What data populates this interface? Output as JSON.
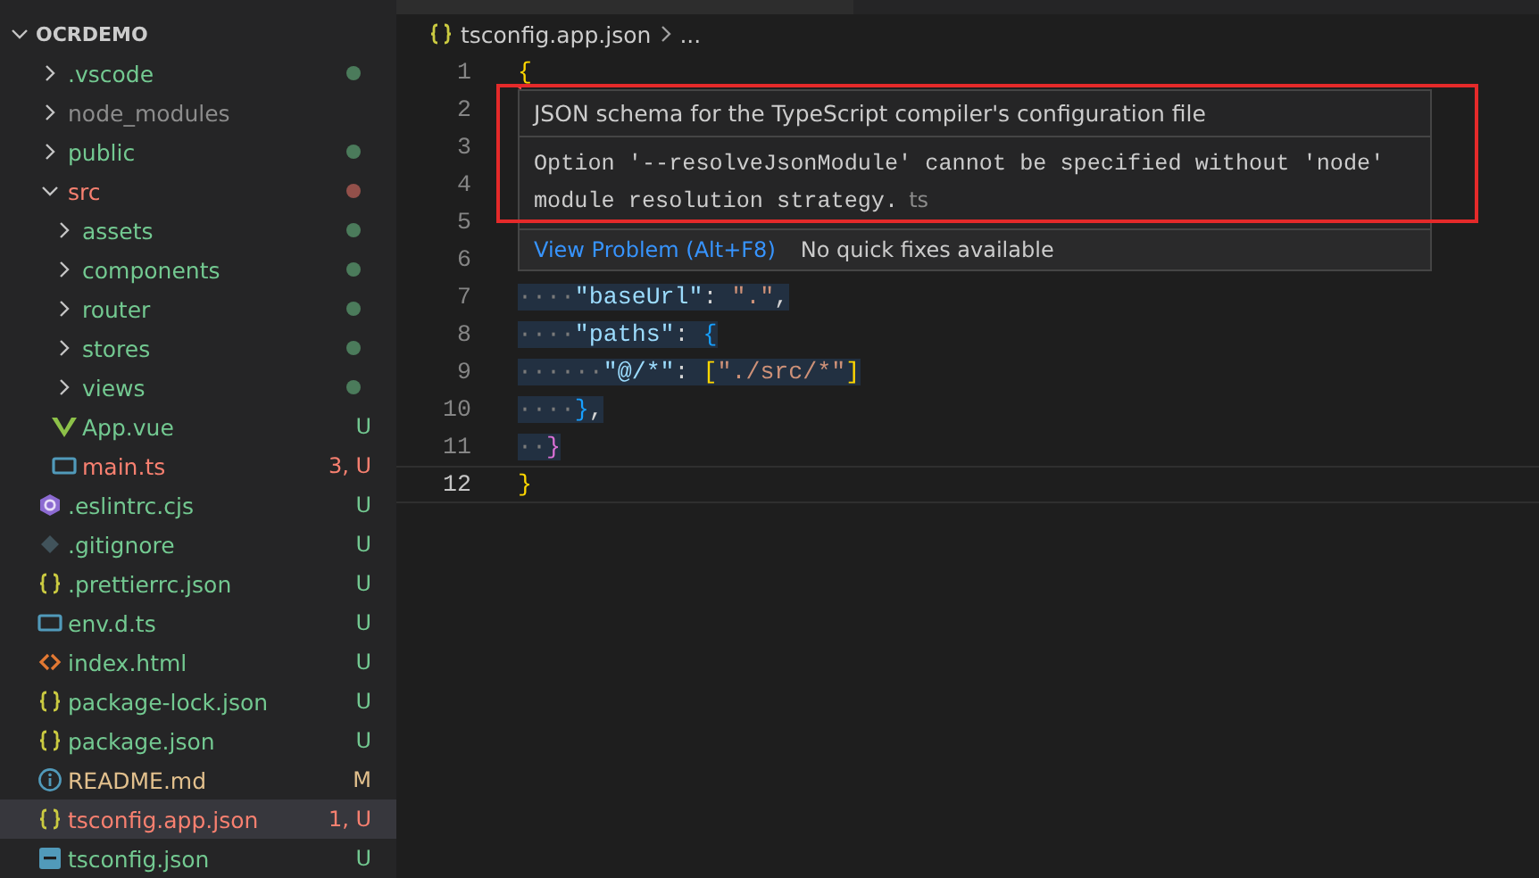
{
  "explorer": {
    "title": "OCRDEMO",
    "expanded": true,
    "items": [
      {
        "name": ".vscode",
        "kind": "folder",
        "expanded": false,
        "selected": false,
        "color": "#73c991",
        "decoration": {
          "kind": "dot",
          "color": "#4b7b5b"
        }
      },
      {
        "name": "node_modules",
        "kind": "folder",
        "expanded": false,
        "selected": false,
        "color": "#8c8c8c"
      },
      {
        "name": "public",
        "kind": "folder",
        "expanded": false,
        "selected": false,
        "color": "#73c991",
        "decoration": {
          "kind": "dot",
          "color": "#4b7b5b"
        }
      },
      {
        "name": "src",
        "kind": "folder",
        "expanded": true,
        "selected": false,
        "color": "#f88070",
        "decoration": {
          "kind": "dot",
          "color": "#93504a"
        },
        "children": [
          {
            "name": "assets",
            "kind": "folder",
            "expanded": false,
            "selected": false,
            "color": "#73c991",
            "decoration": {
              "kind": "dot",
              "color": "#4b7b5b"
            }
          },
          {
            "name": "components",
            "kind": "folder",
            "expanded": false,
            "selected": false,
            "color": "#73c991",
            "decoration": {
              "kind": "dot",
              "color": "#4b7b5b"
            }
          },
          {
            "name": "router",
            "kind": "folder",
            "expanded": false,
            "selected": false,
            "color": "#73c991",
            "decoration": {
              "kind": "dot",
              "color": "#4b7b5b"
            }
          },
          {
            "name": "stores",
            "kind": "folder",
            "expanded": false,
            "selected": false,
            "color": "#73c991",
            "decoration": {
              "kind": "dot",
              "color": "#4b7b5b"
            }
          },
          {
            "name": "views",
            "kind": "folder",
            "expanded": false,
            "selected": false,
            "color": "#73c991",
            "decoration": {
              "kind": "dot",
              "color": "#4b7b5b"
            }
          },
          {
            "name": "App.vue",
            "kind": "vue",
            "selected": false,
            "color": "#73c991",
            "decoration": {
              "kind": "letter",
              "text": "U"
            }
          },
          {
            "name": "main.ts",
            "kind": "ts",
            "selected": false,
            "color": "#f88070",
            "decoration": {
              "kind": "letter",
              "text": "3, U"
            }
          }
        ]
      },
      {
        "name": ".eslintrc.cjs",
        "kind": "eslint",
        "selected": false,
        "color": "#73c991",
        "decoration": {
          "kind": "letter",
          "text": "U"
        }
      },
      {
        "name": ".gitignore",
        "kind": "git",
        "selected": false,
        "color": "#73c991",
        "decoration": {
          "kind": "letter",
          "text": "U"
        }
      },
      {
        "name": ".prettierrc.json",
        "kind": "json",
        "selected": false,
        "color": "#73c991",
        "decoration": {
          "kind": "letter",
          "text": "U"
        }
      },
      {
        "name": "env.d.ts",
        "kind": "ts",
        "selected": false,
        "color": "#73c991",
        "decoration": {
          "kind": "letter",
          "text": "U"
        }
      },
      {
        "name": "index.html",
        "kind": "html",
        "selected": false,
        "color": "#73c991",
        "decoration": {
          "kind": "letter",
          "text": "U"
        }
      },
      {
        "name": "package-lock.json",
        "kind": "json",
        "selected": false,
        "color": "#73c991",
        "decoration": {
          "kind": "letter",
          "text": "U"
        }
      },
      {
        "name": "package.json",
        "kind": "json",
        "selected": false,
        "color": "#73c991",
        "decoration": {
          "kind": "letter",
          "text": "U"
        }
      },
      {
        "name": "README.md",
        "kind": "info",
        "selected": false,
        "color": "#e2c08d",
        "decoration": {
          "kind": "letter",
          "text": "M"
        }
      },
      {
        "name": "tsconfig.app.json",
        "kind": "json",
        "selected": true,
        "color": "#f88070",
        "decoration": {
          "kind": "letter",
          "text": "1, U"
        }
      },
      {
        "name": "tsconfig.json",
        "kind": "tsconfig",
        "selected": false,
        "color": "#73c991",
        "decoration": {
          "kind": "letter",
          "text": "U"
        }
      }
    ]
  },
  "breadcrumb": {
    "file": "tsconfig.app.json",
    "rest": "..."
  },
  "editor": {
    "lines": [
      {
        "number": "1",
        "current": false,
        "tokens": [
          {
            "kind": "bracket1",
            "text": "{",
            "error": true
          }
        ]
      },
      {
        "number": "2",
        "current": false
      },
      {
        "number": "3",
        "current": false
      },
      {
        "number": "4",
        "current": false
      },
      {
        "number": "5",
        "current": false
      },
      {
        "number": "6",
        "current": false
      },
      {
        "number": "7",
        "current": false,
        "selected": true,
        "tokens": [
          {
            "kind": "space",
            "text": "····"
          },
          {
            "kind": "key",
            "text": "\"baseUrl\""
          },
          {
            "kind": "punct",
            "text": ": "
          },
          {
            "kind": "string",
            "text": "\".\""
          },
          {
            "kind": "punct",
            "text": ","
          }
        ]
      },
      {
        "number": "8",
        "current": false,
        "selected": true,
        "tokens": [
          {
            "kind": "space",
            "text": "····"
          },
          {
            "kind": "key",
            "text": "\"paths\""
          },
          {
            "kind": "punct",
            "text": ": "
          },
          {
            "kind": "bracket3",
            "text": "{"
          }
        ]
      },
      {
        "number": "9",
        "current": false,
        "selected": true,
        "tokens": [
          {
            "kind": "space",
            "text": "······"
          },
          {
            "kind": "key",
            "text": "\"@/*\""
          },
          {
            "kind": "punct",
            "text": ": "
          },
          {
            "kind": "bracket1",
            "text": "["
          },
          {
            "kind": "string",
            "text": "\"./src/*\""
          },
          {
            "kind": "bracket1",
            "text": "]"
          }
        ]
      },
      {
        "number": "10",
        "current": false,
        "selected": true,
        "tokens": [
          {
            "kind": "space",
            "text": "····"
          },
          {
            "kind": "bracket3",
            "text": "}"
          },
          {
            "kind": "punct",
            "text": ","
          }
        ]
      },
      {
        "number": "11",
        "current": false,
        "selected": true,
        "tokens": [
          {
            "kind": "space",
            "text": "··"
          },
          {
            "kind": "bracket2",
            "text": "}"
          }
        ]
      },
      {
        "number": "12",
        "current": true,
        "tokens": [
          {
            "kind": "bracket1",
            "text": "}"
          }
        ]
      }
    ]
  },
  "hover": {
    "title": "JSON schema for the TypeScript compiler's configuration file",
    "message": "Option '--resolveJsonModule' cannot be specified without 'node' module resolution strategy.",
    "source": "ts",
    "action": "View Problem (Alt+F8)",
    "note": "No quick fixes available",
    "highlighted": true
  }
}
